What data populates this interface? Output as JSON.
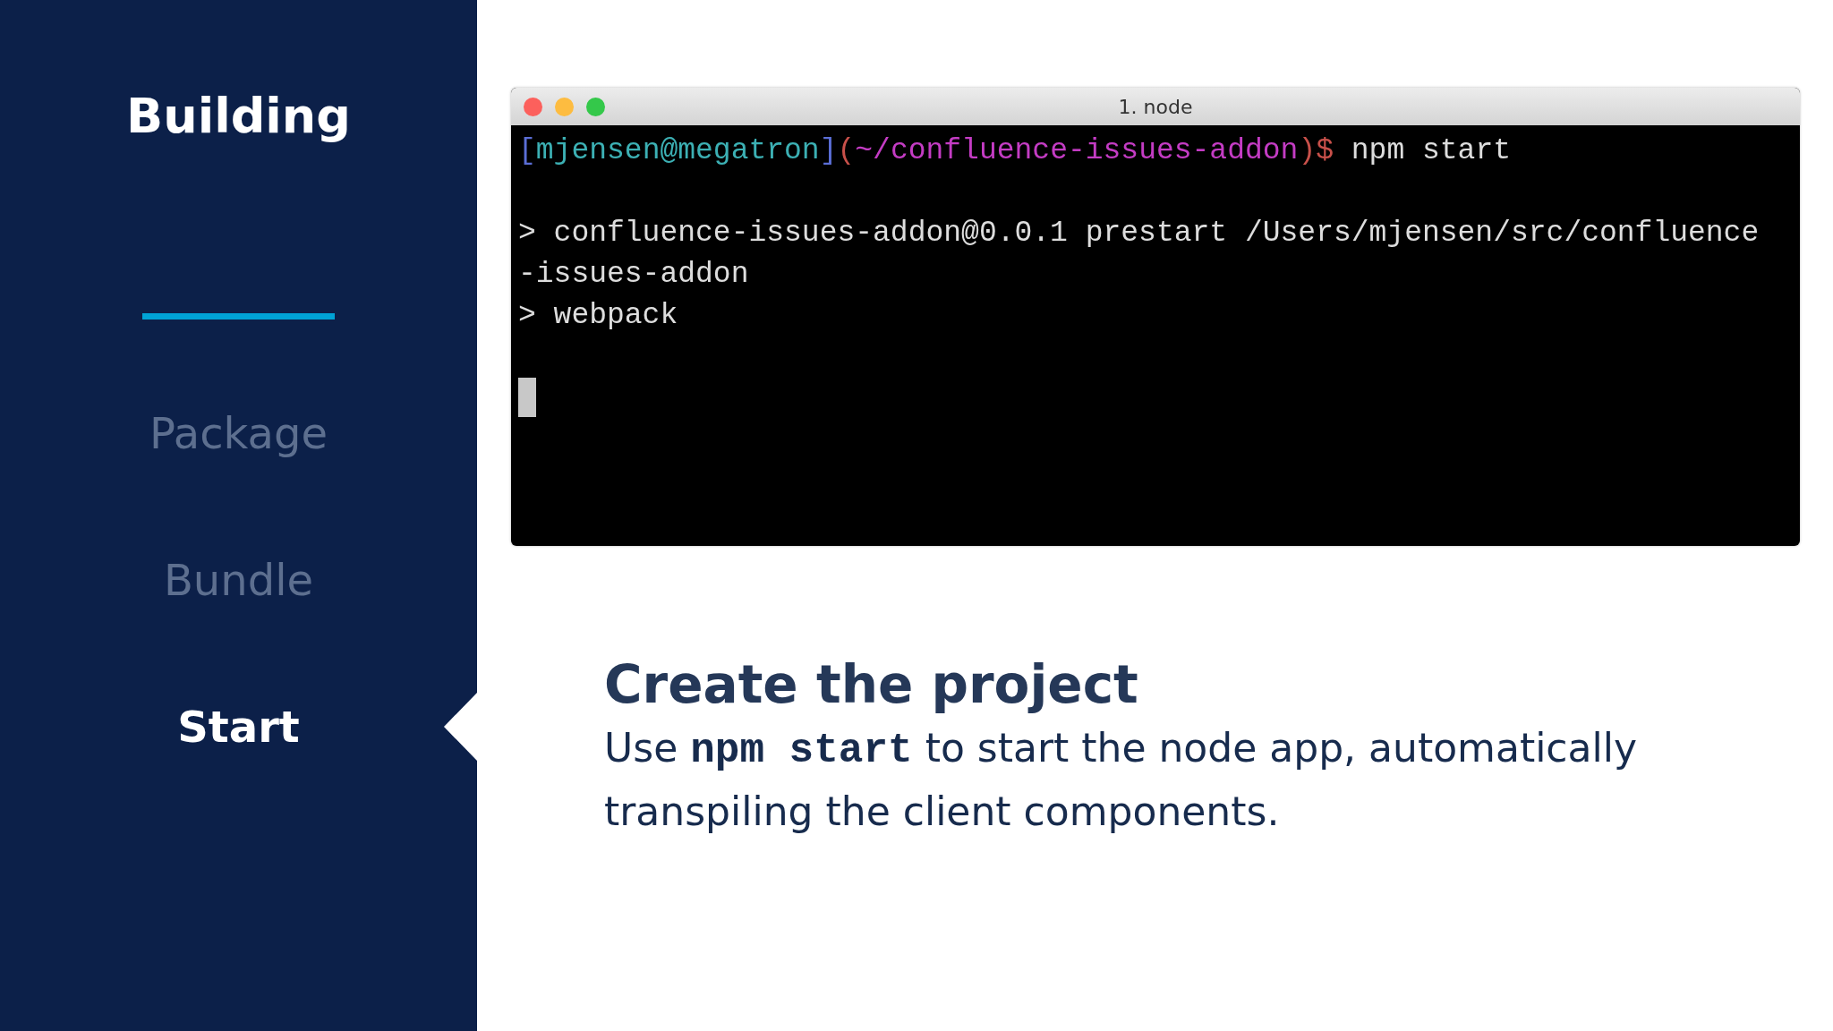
{
  "sidebar": {
    "title": "Building",
    "items": [
      {
        "label": "Package",
        "selected": false
      },
      {
        "label": "Bundle",
        "selected": false
      },
      {
        "label": "Start",
        "selected": true
      }
    ]
  },
  "terminal": {
    "title": "1. node",
    "prompt": [
      {
        "text": "[",
        "color": "#5b6ed6"
      },
      {
        "text": "mjensen@megatron",
        "color": "#3cb0b4"
      },
      {
        "text": "]",
        "color": "#5b6ed6"
      },
      {
        "text": "(",
        "color": "#c8504a"
      },
      {
        "text": "~/confluence-issues-addon",
        "color": "#c43cc4"
      },
      {
        "text": ")$",
        "color": "#c8504a"
      }
    ],
    "command": "npm start",
    "output": [
      "> confluence-issues-addon@0.0.1 prestart /Users/mjensen/src/confluence",
      "-issues-addon",
      "> webpack"
    ]
  },
  "caption": {
    "heading": "Create the project",
    "body": "Use **npm start** to start the node app, automatically transpiling the client components."
  }
}
